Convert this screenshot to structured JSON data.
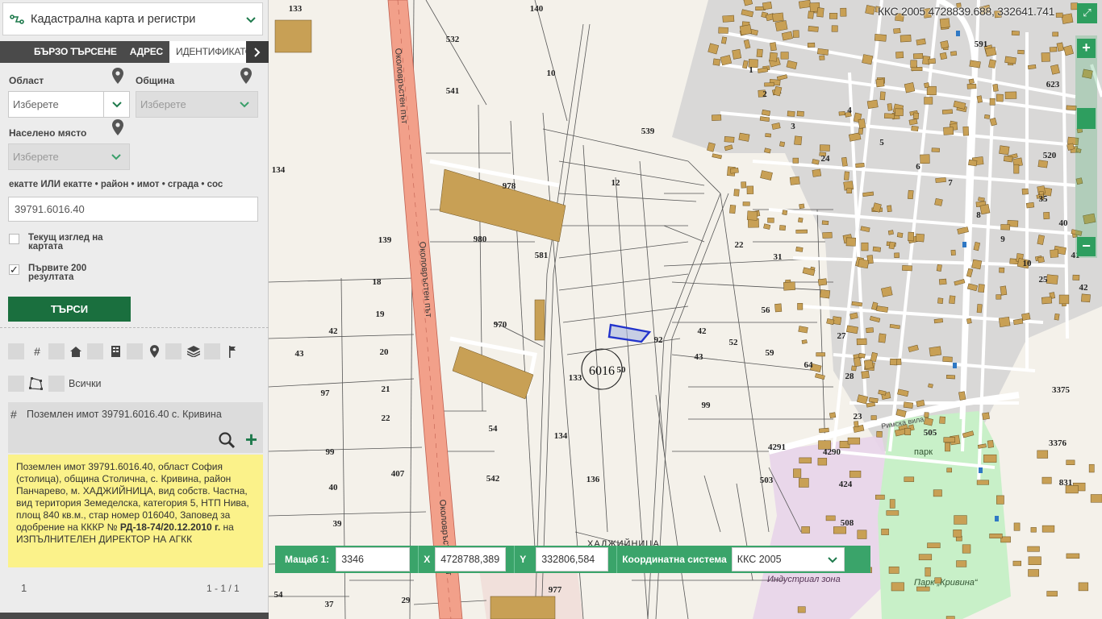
{
  "app": {
    "title": "Кадастрална карта и регистри"
  },
  "tabs": [
    {
      "label": "БЪРЗО ТЪРСЕНЕ"
    },
    {
      "label": "АДРЕС"
    },
    {
      "label": "ИДЕНТИФИКАТОР"
    }
  ],
  "form": {
    "oblast_label": "Област",
    "oblast_value": "Изберете",
    "obshtina_label": "Община",
    "obshtina_value": "Изберете",
    "naseleno_label": "Населено място",
    "naseleno_value": "Изберете",
    "ident_label": "екатте ИЛИ екатте • район • имот • сграда • сос",
    "ident_value": "39791.6016.40",
    "current_view_label": "Текущ изглед на картата",
    "first200_label": "Първите 200 резултата",
    "first200_checked": "✓",
    "search_button": "ТЪРСИ"
  },
  "tools": {
    "all_label": "Всички"
  },
  "result": {
    "title": "Поземлен имот 39791.6016.40 с. Кривина",
    "info_part1": "Поземлен имот 39791.6016.40, област София (столица), община Столична, с. Кривина, район Панчарево, м. ХАДЖИЙНИЦА, вид собств. Частна, вид територия Земеделска, категория 5, НТП Нива, площ 840 кв.м., стар номер 016040, Заповед за одобрение на КККР №",
    "info_bold1": "РД-18-74/20.12.2010 г.",
    "info_part2": "на ИЗПЪЛНИТЕЛЕН ДИРЕКТОР НА АГКК"
  },
  "pager": {
    "page": "1",
    "range": "1 - 1 / 1"
  },
  "map": {
    "coord_readout": "ККС 2005 4728839.688, 332641.741",
    "road_label": "Околовръстен път",
    "locality_label": "ХАДЖИЙНИЦА",
    "cadastral_zone": "6016",
    "park_label": "Парк „Кривина“",
    "park_small": "парк",
    "zone_label": "Индустриал зона",
    "street_label": "Римска вила",
    "parcel_labels": [
      "140",
      "532",
      "10",
      "541",
      "133",
      "134",
      "978",
      "12",
      "539",
      "980",
      "581",
      "139",
      "18",
      "19",
      "42",
      "43",
      "970",
      "20",
      "92",
      "133",
      "50",
      "97",
      "21",
      "22",
      "99",
      "40",
      "39",
      "407",
      "54",
      "134",
      "542",
      "136",
      "977",
      "29",
      "37",
      "54",
      "22",
      "31",
      "56",
      "42",
      "52",
      "43",
      "59",
      "64",
      "99",
      "4291",
      "4290",
      "503",
      "424",
      "508",
      "505",
      "3375",
      "3376",
      "831",
      "591",
      "623",
      "520",
      "1",
      "2",
      "3",
      "4",
      "5",
      "6",
      "7",
      "8",
      "9",
      "10",
      "25",
      "27",
      "28",
      "35",
      "40",
      "41",
      "42",
      "23",
      "24"
    ]
  },
  "bottom_bar": {
    "scale_label": "Мащаб  1:",
    "scale_value": "3346",
    "x_label": "X",
    "x_value": "4728788,389",
    "y_label": "Y",
    "y_value": "332806,584",
    "cs_label": "Координатна система",
    "cs_value": "ККС 2005"
  },
  "colors": {
    "accent": "#1a6f3e",
    "accent_light": "#3aa46a",
    "road": "#f2a08a",
    "building": "#c8a055",
    "urban": "#d4d4d4",
    "industrial": "#e8d4ea",
    "park": "#c8f0c8",
    "selected_parcel": "#2233cc",
    "info_bg": "#fbf28a"
  }
}
